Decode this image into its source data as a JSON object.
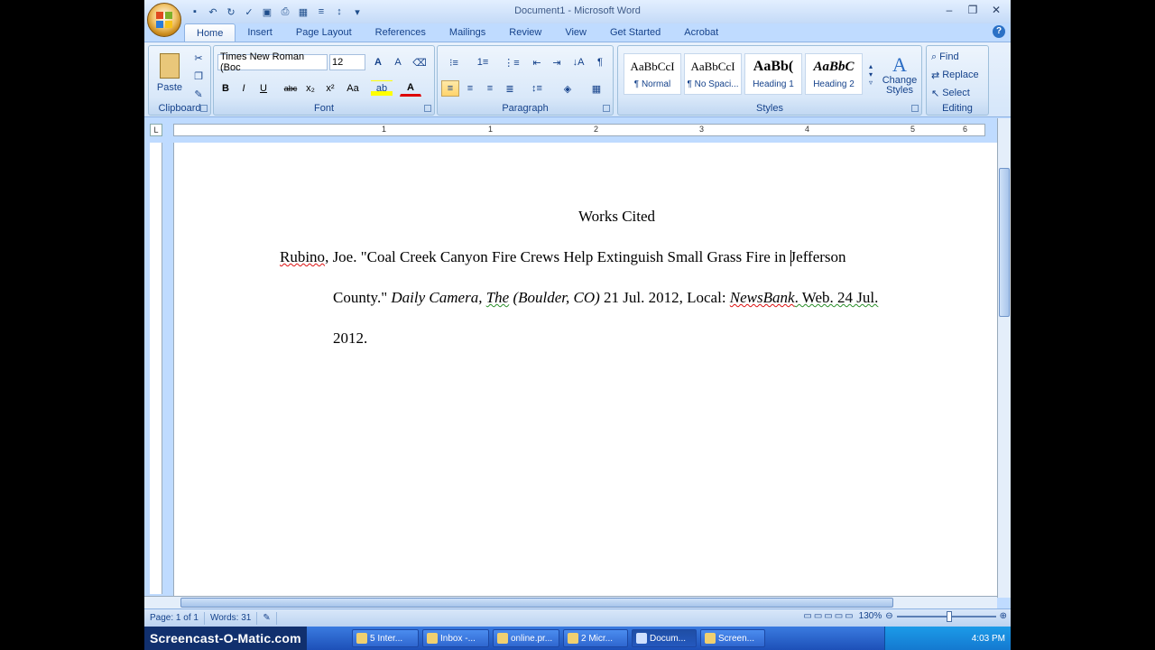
{
  "window": {
    "title": "Document1 - Microsoft Word"
  },
  "tabs": [
    "Home",
    "Insert",
    "Page Layout",
    "References",
    "Mailings",
    "Review",
    "View",
    "Get Started",
    "Acrobat"
  ],
  "active_tab": "Home",
  "ribbon": {
    "clipboard": {
      "label": "Clipboard",
      "paste": "Paste"
    },
    "font": {
      "label": "Font",
      "font_name": "Times New Roman (Boc",
      "font_size": "12"
    },
    "paragraph": {
      "label": "Paragraph"
    },
    "styles": {
      "label": "Styles",
      "tiles": [
        {
          "preview": "AaBbCcI",
          "name": "¶ Normal"
        },
        {
          "preview": "AaBbCcI",
          "name": "¶ No Spaci..."
        },
        {
          "preview": "AaBb(",
          "name": "Heading 1"
        },
        {
          "preview": "AaBbC",
          "name": "Heading 2"
        }
      ],
      "change_styles": "Change Styles"
    },
    "editing": {
      "label": "Editing",
      "find": "Find",
      "replace": "Replace",
      "select": "Select"
    }
  },
  "ruler": {
    "numbers": [
      "1",
      "1",
      "2",
      "3",
      "4",
      "5",
      "6"
    ]
  },
  "document": {
    "heading": "Works Cited",
    "line1": {
      "a": "Rubino",
      "b": ", Joe. \"Coal Creek Canyon Fire Crews Help Extinguish Small Grass Fire in ",
      "c": "Jefferson"
    },
    "line2": {
      "a": "County.\" ",
      "b": "Daily Camera, ",
      "c": "The",
      "d": " (Boulder, CO)",
      "e": " 21 Jul. 2012, Local: ",
      "f": "NewsBank",
      "g": ". Web. 24 Jul."
    },
    "line3": "2012."
  },
  "status": {
    "page": "Page: 1 of 1",
    "words": "Words: 31",
    "zoom": "130%"
  },
  "taskbar": {
    "brand": "Screencast-O-Matic.com",
    "items": [
      "5 Inter...",
      "Inbox -...",
      "online.pr...",
      "2 Micr...",
      "Docum...",
      "Screen..."
    ],
    "clock": "4:03 PM"
  }
}
